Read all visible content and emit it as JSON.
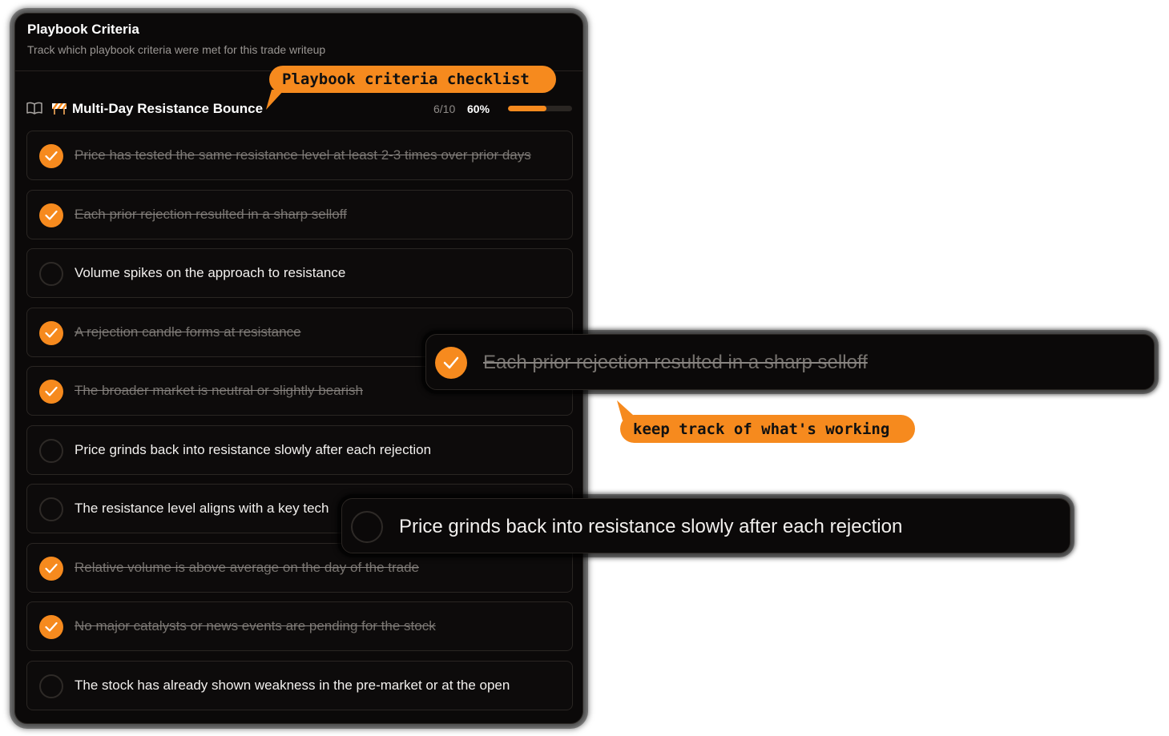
{
  "panel": {
    "title": "Playbook Criteria",
    "subtitle": "Track which playbook criteria were met for this trade writeup"
  },
  "playbook": {
    "icon": "book-open-icon",
    "emoji": "barrier-icon",
    "name": "Multi-Day Resistance Bounce",
    "count": "6/10",
    "percent_label": "60%",
    "progress": 0.6
  },
  "criteria": [
    {
      "text": "Price has tested the same resistance level at least 2-3 times over prior days",
      "checked": true
    },
    {
      "text": "Each prior rejection resulted in a sharp selloff",
      "checked": true
    },
    {
      "text": "Volume spikes on the approach to resistance",
      "checked": false
    },
    {
      "text": "A rejection candle forms at resistance",
      "checked": true
    },
    {
      "text": "The broader market is neutral or slightly bearish",
      "checked": true
    },
    {
      "text": "Price grinds back into resistance slowly after each rejection",
      "checked": false
    },
    {
      "text": "The resistance level aligns with a key tech",
      "checked": false
    },
    {
      "text": "Relative volume is above average on the day of the trade",
      "checked": true
    },
    {
      "text": "No major catalysts or news events are pending for the stock",
      "checked": true
    },
    {
      "text": "The stock has already shown weakness in the pre-market or at the open",
      "checked": false
    }
  ],
  "callouts": {
    "checklist": "Playbook criteria checklist",
    "working": "keep track of what's working"
  },
  "zoom": {
    "checked_item": "Each prior rejection resulted in a sharp selloff",
    "unchecked_item": "Price grinds back into resistance slowly after each rejection"
  },
  "colors": {
    "accent": "#f68a1e",
    "background": "#0b0909",
    "border": "#2a2623"
  }
}
